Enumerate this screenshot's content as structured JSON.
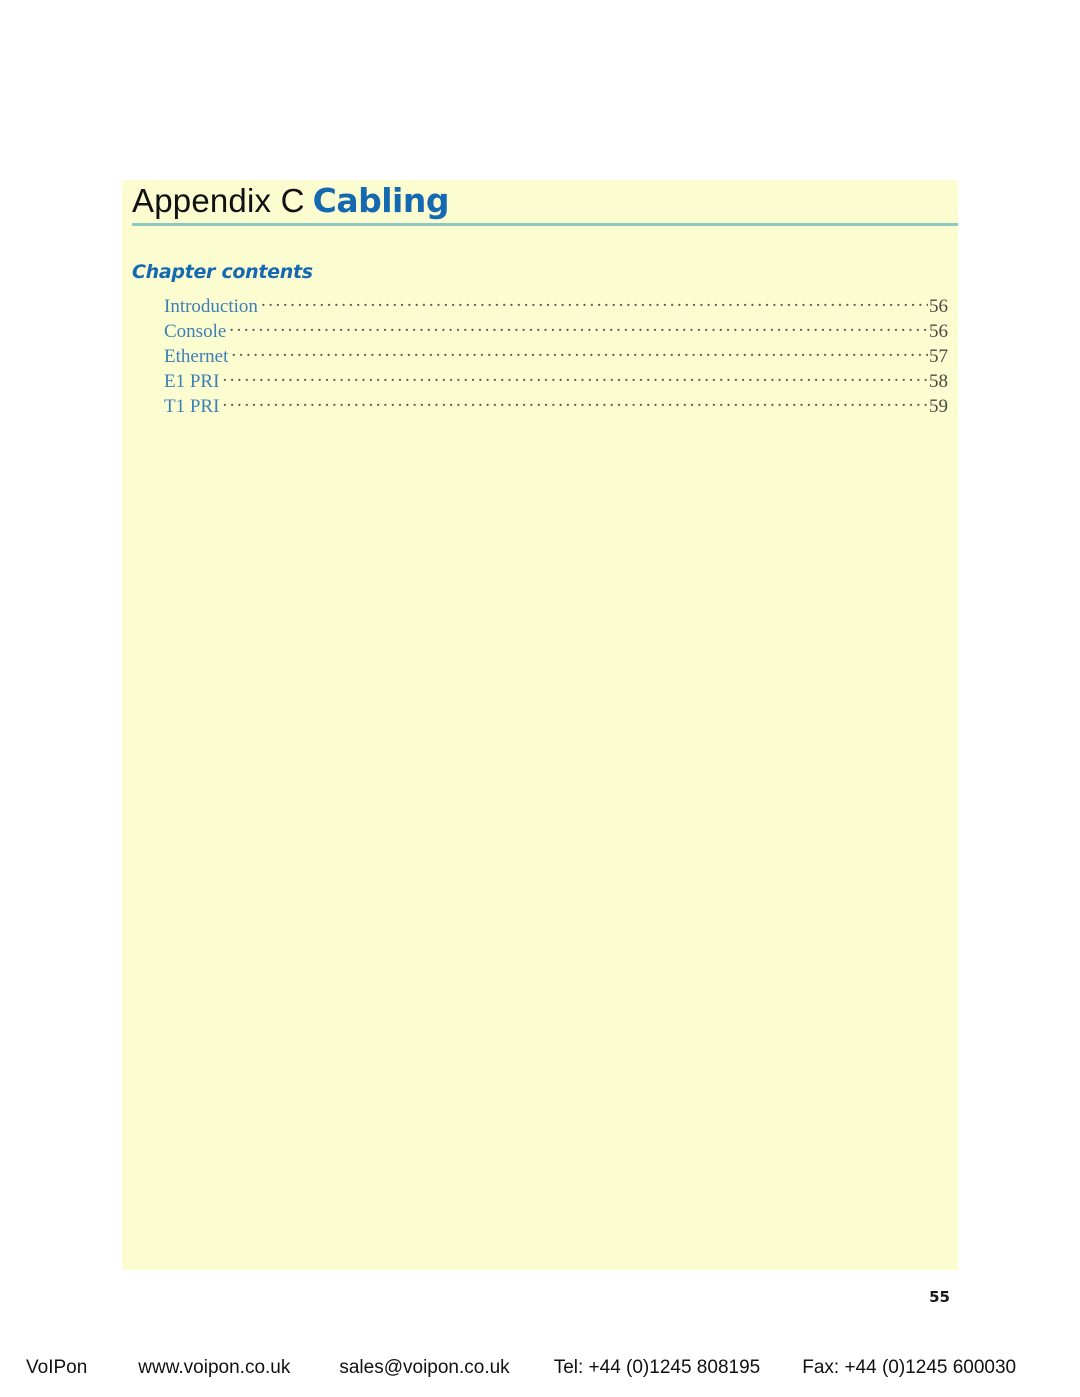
{
  "document": {
    "title_prefix": "Appendix C",
    "title_main": "Cabling",
    "folio": "55"
  },
  "chapter_contents": {
    "heading": "Chapter contents",
    "entries": [
      {
        "label": "Introduction",
        "page": "56"
      },
      {
        "label": "Console",
        "page": "56"
      },
      {
        "label": "Ethernet",
        "page": "57"
      },
      {
        "label": "E1 PRI",
        "page": "58"
      },
      {
        "label": "T1 PRI",
        "page": "59"
      }
    ]
  },
  "footer": {
    "brand": "VoIPon",
    "website": "www.voipon.co.uk",
    "email": "sales@voipon.co.uk",
    "telephone": "Tel: +44 (0)1245 808195",
    "fax": "Fax: +44 (0)1245 600030"
  },
  "colors": {
    "panel_background": "#fcfcd1",
    "accent_blue": "#1569b0",
    "toc_blue": "#3d7fb5",
    "divider_teal": "#8dc9c2",
    "page_background": "#ffffff"
  }
}
